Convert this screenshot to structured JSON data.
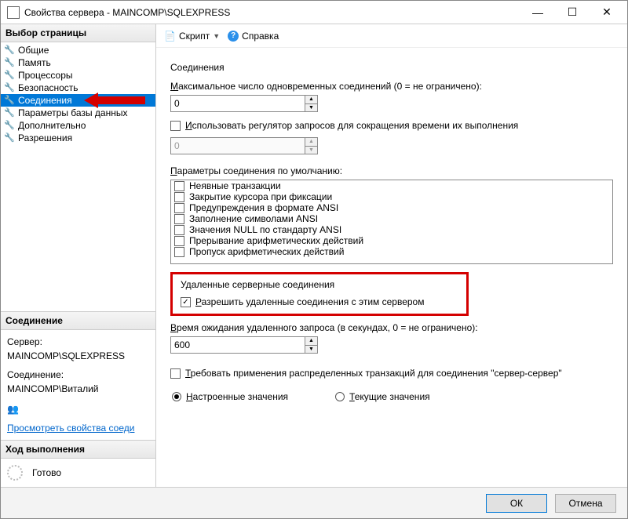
{
  "window": {
    "title": "Свойства сервера - MAINCOMP\\SQLEXPRESS"
  },
  "sidebar": {
    "header": "Выбор страницы",
    "items": [
      {
        "label": "Общие"
      },
      {
        "label": "Память"
      },
      {
        "label": "Процессоры"
      },
      {
        "label": "Безопасность"
      },
      {
        "label": "Соединения"
      },
      {
        "label": "Параметры базы данных"
      },
      {
        "label": "Дополнительно"
      },
      {
        "label": "Разрешения"
      }
    ]
  },
  "connection": {
    "header": "Соединение",
    "server_label": "Сервер:",
    "server_value": "MAINCOMP\\SQLEXPRESS",
    "conn_label": "Соединение:",
    "conn_value": "MAINCOMP\\Виталий",
    "view_link": "Просмотреть свойства соеди"
  },
  "progress": {
    "header": "Ход выполнения",
    "status": "Готово"
  },
  "toolbar": {
    "script": "Скрипт",
    "help": "Справка"
  },
  "form": {
    "sec_conn": "Соединения",
    "max_conn_label": "Максимальное число одновременных соединений (0 = не ограничено):",
    "max_conn_value": "0",
    "use_governor": "Использовать регулятор запросов для сокращения времени их выполнения",
    "governor_value": "0",
    "defaults_label": "Параметры соединения по умолчанию:",
    "options": [
      "Неявные транзакции",
      "Закрытие курсора при фиксации",
      "Предупреждения в формате ANSI",
      "Заполнение символами ANSI",
      "Значения NULL по стандарту ANSI",
      "Прерывание арифметических действий",
      "Пропуск арифметических действий"
    ],
    "remote_header": "Удаленные серверные соединения",
    "allow_remote": "Разрешить удаленные соединения с этим сервером",
    "timeout_label": "Время ожидания удаленного запроса (в секундах, 0 = не ограничено):",
    "timeout_value": "600",
    "require_dtc": "Требовать применения распределенных транзакций для соединения \"сервер-сервер\"",
    "radio_configured": "Настроенные значения",
    "radio_running": "Текущие значения"
  },
  "footer": {
    "ok": "ОК",
    "cancel": "Отмена"
  }
}
